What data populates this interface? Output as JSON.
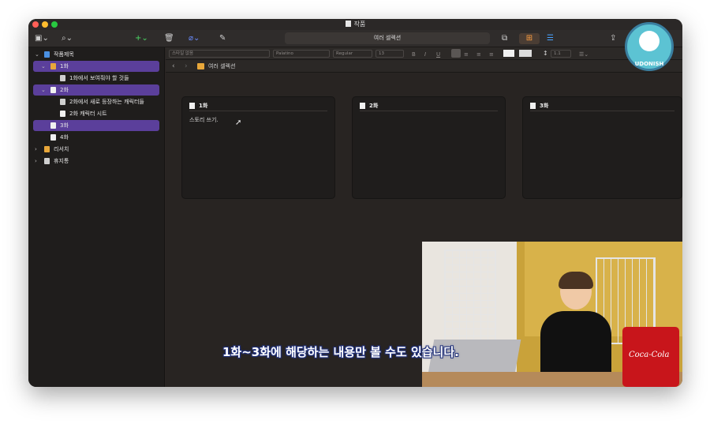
{
  "window": {
    "title": "작품"
  },
  "toolbar": {
    "center_label": "여러 셀렉션"
  },
  "formatbar": {
    "style": "스타일 없음",
    "font": "Palatino",
    "weight": "Regular",
    "size": "13",
    "line_spacing": "1.1"
  },
  "pathbar": {
    "label": "여러 셀렉션"
  },
  "binder": {
    "root": "작품제목",
    "items": [
      {
        "label": "1화",
        "level": 1,
        "selected": true,
        "expanded": true
      },
      {
        "label": "1화에서 보여줘야 할 것들",
        "level": 2
      },
      {
        "label": "2화",
        "level": 1,
        "selected": true,
        "expanded": true
      },
      {
        "label": "2화에서 새로 등장하는 캐릭터들",
        "level": 2
      },
      {
        "label": "2화 캐릭터 시트",
        "level": 2
      },
      {
        "label": "3화",
        "level": 1,
        "selected": true
      },
      {
        "label": "4화",
        "level": 1
      },
      {
        "label": "리서치",
        "level": 0
      },
      {
        "label": "휴지통",
        "level": 0
      }
    ]
  },
  "cards": [
    {
      "title": "1화",
      "body": "스토리 쓰기."
    },
    {
      "title": "2화",
      "body": ""
    },
    {
      "title": "3화",
      "body": ""
    }
  ],
  "overlay": {
    "subtitle": "1화~3화에 해당하는 내용만 볼 수도 있습니다.",
    "logo_text": "UDONISH",
    "sign_text": "Coca-Cola"
  }
}
